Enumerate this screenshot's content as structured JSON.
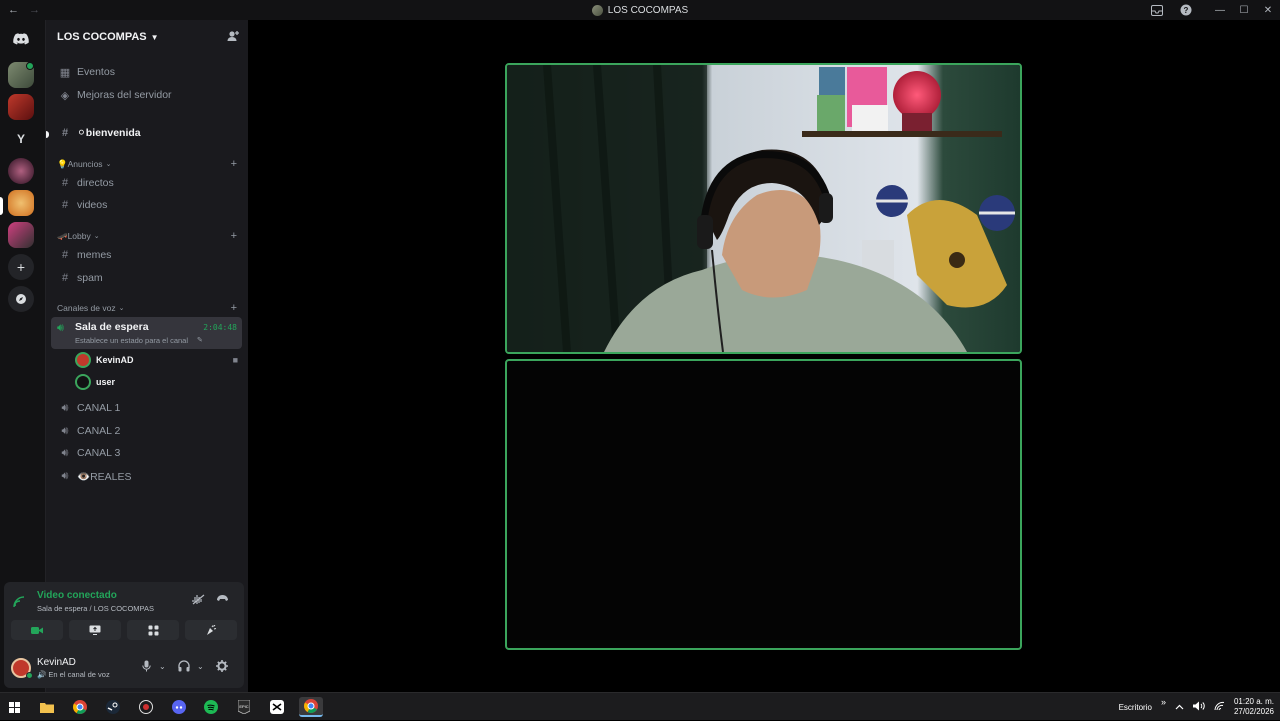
{
  "window": {
    "title": "LOS COCOMPAS",
    "back": "←",
    "forward": "→",
    "inbox_icon": "inbox-icon",
    "help_icon": "help-icon",
    "minimize": "—",
    "maximize": "☐",
    "close": "✕"
  },
  "guilds": {
    "home_icon": "discord-logo-icon",
    "letter_server": "Y",
    "add_server": "+",
    "discover": "compass-icon"
  },
  "server": {
    "name": "LOS COCOMPAS",
    "events": "Eventos",
    "boosts": "Mejoras del servidor",
    "welcome_channel": "⚪bienvenida",
    "categories": [
      {
        "name": "💡Anuncios",
        "channels": [
          "directos",
          "videos"
        ]
      },
      {
        "name": "🛹Lobby",
        "channels": [
          "memes",
          "spam"
        ]
      }
    ],
    "voice_category": "Canales de voz",
    "active_voice": {
      "name": "Sala de espera",
      "status": "Establece un estado para el canal",
      "timer": "2:04:48",
      "users": [
        "KevinAD",
        "user"
      ]
    },
    "other_voice": [
      "CANAL 1",
      "CANAL 2",
      "CANAL 3",
      "👁️REALES"
    ]
  },
  "voice_panel": {
    "title": "Video conectado",
    "subtitle": "Sala de espera / LOS COCOMPAS"
  },
  "user_panel": {
    "name": "KevinAD",
    "status": "🔊 En el canal de voz"
  },
  "taskbar": {
    "desktop_label": "Escritorio",
    "overflow": "»",
    "time": "01:20 a. m.",
    "date": "27/02/2026"
  },
  "colors": {
    "accent_green": "#23a55a",
    "speaking_border": "#3ba55c",
    "sidebar_bg": "#1a1a1e",
    "guilds_bg": "#121214"
  }
}
